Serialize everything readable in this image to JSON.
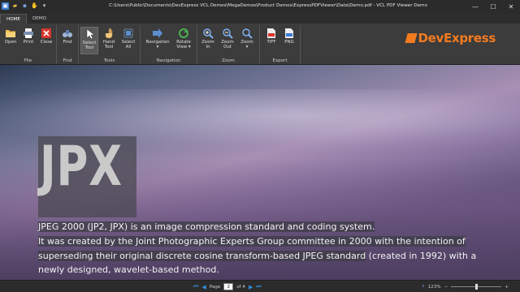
{
  "window": {
    "title": "C:\\Users\\Public\\Documents\\DevExpress VCL Demos\\MegaDemos\\Product Demos\\ExpressPDFViewer\\Data\\Demo.pdf - VCL PDF Viewer Demo",
    "quick_access": [
      "app-menu-icon",
      "open-icon",
      "save-icon",
      "hand-icon",
      "dropdown-icon"
    ],
    "controls": {
      "minimize": "—",
      "maximize": "☐",
      "close": "✕"
    }
  },
  "tabs": [
    {
      "label": "HOME",
      "active": true
    },
    {
      "label": "DEMO",
      "active": false
    }
  ],
  "ribbon": {
    "groups": [
      {
        "label": "File",
        "buttons": [
          {
            "label": "Open",
            "icon": "folder-icon"
          },
          {
            "label": "Print",
            "icon": "printer-icon"
          },
          {
            "label": "Close",
            "icon": "close-doc-icon"
          }
        ]
      },
      {
        "label": "Find",
        "buttons": [
          {
            "label": "Find",
            "icon": "binoculars-icon"
          }
        ]
      },
      {
        "label": "Tools",
        "buttons": [
          {
            "label": "Select Tool",
            "icon": "cursor-icon",
            "selected": true
          },
          {
            "label": "Hand Tool",
            "icon": "hand-icon"
          },
          {
            "label": "Select All",
            "icon": "select-all-icon"
          }
        ]
      },
      {
        "label": "Navigation",
        "buttons": [
          {
            "label": "Navigation",
            "icon": "navigation-icon",
            "dropdown": "▾"
          },
          {
            "label": "Rotate View",
            "icon": "rotate-icon",
            "dropdown": "▾"
          }
        ]
      },
      {
        "label": "Zoom",
        "buttons": [
          {
            "label": "Zoom In",
            "icon": "zoom-in-icon"
          },
          {
            "label": "Zoom Out",
            "icon": "zoom-out-icon"
          },
          {
            "label": "Zoom",
            "icon": "zoom-icon",
            "dropdown": "▾"
          }
        ]
      },
      {
        "label": "Export",
        "buttons": [
          {
            "label": "TIFF",
            "icon": "tiff-icon"
          },
          {
            "label": "PNG",
            "icon": "png-icon"
          }
        ]
      }
    ],
    "logo": "DevExpress"
  },
  "document": {
    "heading": "JPX",
    "lines": [
      {
        "highlight": "JPEG 2000 (JP2, JPX) is an image compression standard and coding system.",
        "rest": ""
      },
      {
        "highlight": "It was created by the Joint Photographic Experts Group committee in 2000 with the intention of",
        "rest": ""
      },
      {
        "highlight": "superseding their original discrete cosine transform-based JPEG standard",
        "rest": " (created in 1992) with a"
      },
      {
        "highlight": "",
        "rest": "newly designed, wavelet-based method."
      }
    ]
  },
  "statusbar": {
    "page_label": "Page",
    "page_value": "2",
    "of_label": "of 4",
    "zoom_level": "123%",
    "zoom_fraction": 0.5
  },
  "colors": {
    "accent": "#f37b20",
    "nav_blue": "#2f8bd8",
    "ribbon_bg": "#3c3c3c"
  }
}
